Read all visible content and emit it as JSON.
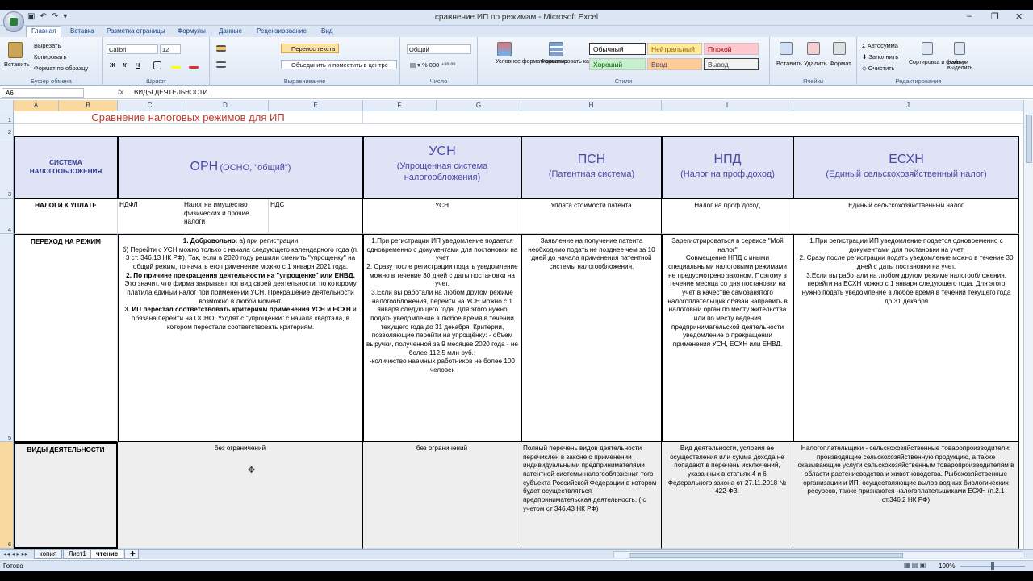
{
  "window": {
    "title": "сравнение ИП по режимам - Microsoft Excel"
  },
  "tabs": [
    "Главная",
    "Вставка",
    "Разметка страницы",
    "Формулы",
    "Данные",
    "Рецензирование",
    "Вид"
  ],
  "ribbon": {
    "clipboard": {
      "label": "Буфер обмена",
      "paste": "Вставить",
      "cut": "Вырезать",
      "copy": "Копировать",
      "format_painter": "Формат по образцу"
    },
    "font": {
      "label": "Шрифт",
      "name": "Calibri",
      "size": "12",
      "bold": "Ж",
      "italic": "К",
      "underline": "Ч"
    },
    "alignment": {
      "label": "Выравнивание",
      "wrap": "Перенос текста",
      "merge": "Объединить и поместить в центре"
    },
    "number": {
      "label": "Число",
      "format": "Общий"
    },
    "styles": {
      "label": "Стили",
      "cond_format": "Условное форматирование",
      "format_table": "Форматировать как таблицу",
      "normal": "Обычный",
      "neutral": "Нейтральный",
      "bad": "Плохой",
      "good": "Хороший",
      "input": "Ввод",
      "output": "Вывод"
    },
    "cells": {
      "label": "Ячейки",
      "insert": "Вставить",
      "delete": "Удалить",
      "format": "Формат"
    },
    "editing": {
      "label": "Редактирование",
      "autosum": "Автосумма",
      "fill": "Заполнить",
      "clear": "Очистить",
      "sort": "Сортировка и фильтр",
      "find": "Найти и выделить"
    }
  },
  "formula_bar": {
    "name_box": "A6",
    "fx": "fx",
    "content": "ВИДЫ ДЕЯТЕЛЬНОСТИ"
  },
  "columns": [
    "A",
    "B",
    "C",
    "D",
    "E",
    "F",
    "G",
    "H",
    "I",
    "J"
  ],
  "rows": [
    "1",
    "2",
    "3",
    "4",
    "5",
    "6"
  ],
  "sheet": {
    "title": "Сравнение налоговых режимов для ИП",
    "r3": {
      "a": "СИСТЕМА НАЛОГООБЛОЖЕНИЯ",
      "orn": "ОРН",
      "orn_sub": "(ОСНО, \"общий\")",
      "usn": "УСН",
      "usn_sub": "(Упрощенная система налогообложения)",
      "psn": "ПСН",
      "psn_sub": "(Патентная система)",
      "npd": "НПД",
      "npd_sub": "(Налог на проф.доход)",
      "eshn": "ЕСХН",
      "eshn_sub": "(Единый сельскохозяйственный налог)"
    },
    "r4": {
      "a": "НАЛОГИ К УПЛАТЕ",
      "c": "НДФЛ",
      "d": "Налог на имущество физических и прочие налоги",
      "e": "НДС",
      "f": "УСН",
      "h": "Уплата стоимости патента",
      "i": "Налог на проф.доход",
      "j": "Единый сельскохозяйственный налог"
    },
    "r5": {
      "a": "ПЕРЕХОД НА РЕЖИМ",
      "c1b": "1. Добровольно.",
      "c1": " а) при регистрации",
      "c2": "б) Перейти с УСН можно только с начала следующего календарного года (п. 3 ст. 346.13 НК РФ). Так, если в 2020 году решили сменить \"упрощенку\" на общий режим, то начать его применение можно с 1 января 2021 года.",
      "c3b": "2. По причине прекращения деятельности на \"упрощенке\" или ЕНВД.",
      "c3": " Это значит, что фирма закрывает тот вид своей деятельности, по которому платила единый налог при применении УСН. Прекращение деятельности возможно в любой момент.",
      "c4b": "3. ИП перестал соответствовать критериям применения УСН и ЕСХН",
      "c4": " и обязана перейти на ОСНО. Уходят с \"упрощенки\" с начала квартала, в котором перестали соответствовать критериям.",
      "f": "1.При регистрации ИП уведомление подается одновременно с документами для постановки на учет\n2. Сразу после регистрации подать уведомление можно в течение 30 дней с даты постановки на учет.\n3.Если вы работали на любом другом режиме налогообложения, перейти на УСН можно с 1 января следующего года. Для этого нужно подать уведомление в любое время в течении текущего года до 31 декабря. Критерии, позволяющие перейти на упрощёнку: - объем выручки, полученной за 9 месяцев 2020 года - не более 112,5 млн руб.;\n-количество наемных работников не более 100 человек",
      "h": "Заявление на получение патента необходимо подать не позднее чем за 10 дней до начала применения патентной системы налогообложения.",
      "i": "Зарегистрироваться в сервисе \"Мой налог\"\nСовмещение НПД с иными специальными налоговыми режимами не предусмотрено законом. Поэтому в течение месяца со дня постановки на учет в качестве самозанятого налогоплательщик обязан направить в налоговый орган по месту жительства или по месту ведения предпринимательской деятельности уведомление о прекращении применения УСН, ЕСХН или ЕНВД.",
      "j": "1.При регистрации ИП уведомление подается одновременно с документами для постановки на учет\n2. Сразу после регистрации подать уведомление можно в течение 30 дней с даты постановки на учет.\n3.Если вы работали на любом другом режиме налогообложения, перейти на ЕСХН можно с 1 января следующего года. Для этого нужно подать уведомление в любое время в течении текущего года до 31 декабря"
    },
    "r6": {
      "a": "ВИДЫ ДЕЯТЕЛЬНОСТИ",
      "c": "без ограничений",
      "f": "без ограничений",
      "h": "Полный перечень видов деятельности перечислен в законе о применении индивидуальными предпринимателями патентной системы налогообложения того субъекта Российской Федерации в котором будет осуществляться предпринимательская деятельность. ( с учетом ст 346.43 НК РФ)",
      "i": "Вид деятельности, условия ее осуществления или сумма дохода не попадают в перечень исключений, указанных в статьях 4 и 6 Федерального закона от 27.11.2018 № 422-ФЗ.",
      "j": "Налогоплательщики - сельскохозяйственные товаропроизводители: производящие сельскохозяйственную продукцию, а также оказывающие услуги сельскохозяйственным товаропроизводителям в области растениеводства и животноводства. Рыбохозяйственные организации и ИП, осуществляющие вылов водных биологических ресурсов, также признаются налогоплательщиками ЕСХН (п.2.1 ст.346.2 НК РФ)"
    }
  },
  "sheet_tabs": [
    "копия",
    "Лист1",
    "чтение"
  ],
  "status": {
    "ready": "Готово",
    "zoom": "100%"
  },
  "colors": {
    "accent": "#4a4aa8",
    "title": "#c0392b",
    "header_bg": "#e0e2f5",
    "selection": "#f9d99f"
  }
}
